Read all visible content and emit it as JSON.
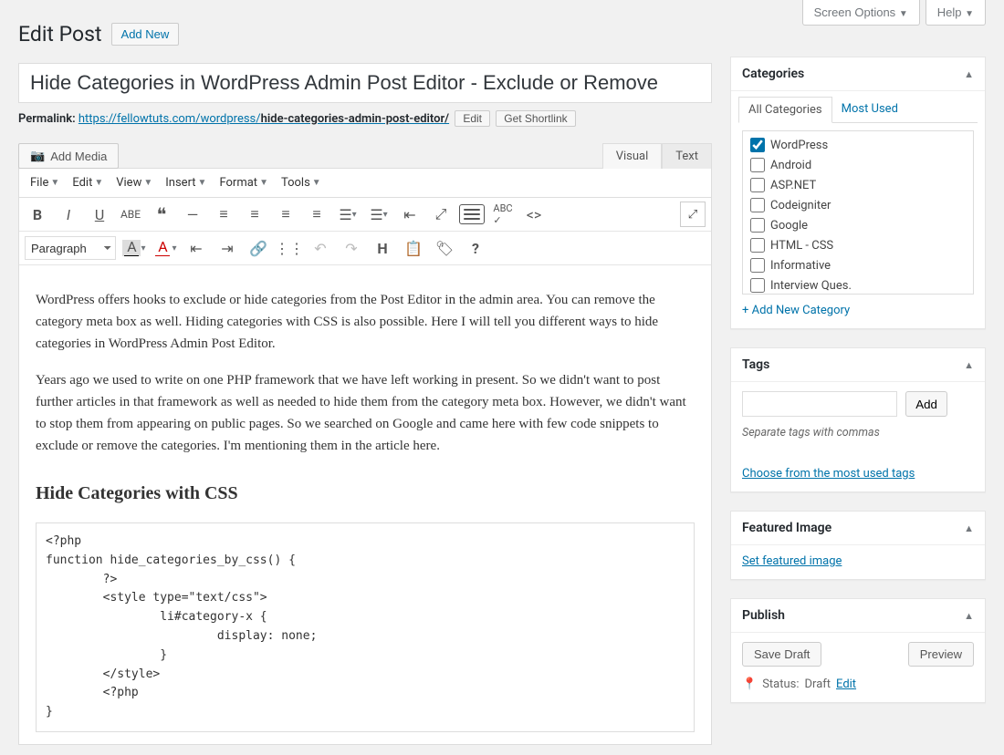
{
  "screenOptions": "Screen Options",
  "helpLabel": "Help",
  "pageTitle": "Edit Post",
  "addNewLabel": "Add New",
  "postTitle": "Hide Categories in WordPress Admin Post Editor - Exclude or Remove",
  "permalinkLabel": "Permalink:",
  "permalinkBase": "https://fellowtuts.com/wordpress/",
  "permalinkSlug": "hide-categories-admin-post-editor/",
  "editBtn": "Edit",
  "shortlinkBtn": "Get Shortlink",
  "addMedia": "Add Media",
  "tabs": {
    "visual": "Visual",
    "text": "Text"
  },
  "menu": {
    "file": "File",
    "edit": "Edit",
    "view": "View",
    "insert": "Insert",
    "format": "Format",
    "tools": "Tools"
  },
  "formatSelect": "Paragraph",
  "content": {
    "p1": "WordPress offers hooks to exclude or hide categories from the Post Editor in the admin area. You can remove the category meta box as well. Hiding categories with CSS is also possible. Here I will tell you different ways to hide categories in WordPress Admin Post Editor.",
    "p2": "Years ago we used to write on one PHP framework that we have left working in present. So we didn't want to post further articles in that framework as well as needed to hide them from the category meta box. However, we didn't want to stop them from appearing on public pages. So we searched on Google and came here with few code snippets to exclude or remove the categories. I'm mentioning them in the article here.",
    "h2": "Hide Categories with CSS",
    "code": "<?php\nfunction hide_categories_by_css() {\n        ?>\n        <style type=\"text/css\">\n                li#category-x {\n                        display: none;\n                }\n        </style>\n        <?php\n}"
  },
  "catBox": {
    "title": "Categories",
    "tabAll": "All Categories",
    "tabMost": "Most Used",
    "items": [
      {
        "label": "WordPress",
        "checked": true
      },
      {
        "label": "Android",
        "checked": false
      },
      {
        "label": "ASP.NET",
        "checked": false
      },
      {
        "label": "Codeigniter",
        "checked": false
      },
      {
        "label": "Google",
        "checked": false
      },
      {
        "label": "HTML - CSS",
        "checked": false
      },
      {
        "label": "Informative",
        "checked": false
      },
      {
        "label": "Interview Ques.",
        "checked": false
      }
    ],
    "addNew": "+ Add New Category"
  },
  "tagBox": {
    "title": "Tags",
    "addBtn": "Add",
    "hint": "Separate tags with commas",
    "choose": "Choose from the most used tags"
  },
  "fiBox": {
    "title": "Featured Image",
    "link": "Set featured image"
  },
  "pubBox": {
    "title": "Publish",
    "saveDraft": "Save Draft",
    "preview": "Preview",
    "statusLabel": "Status:",
    "statusValue": "Draft",
    "statusEdit": "Edit"
  }
}
